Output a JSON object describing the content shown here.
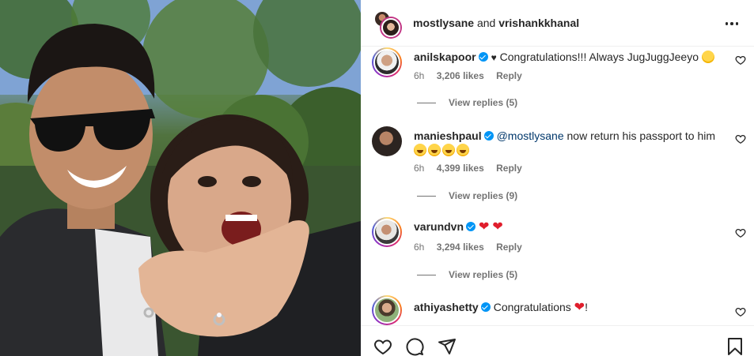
{
  "post": {
    "author": "mostlysane",
    "connector": "and",
    "coauthor": "vrishankkhanal"
  },
  "comments": [
    {
      "user": "anilskapoor",
      "verified": true,
      "prefix": "♥",
      "text": "Congratulations!!! Always JugJuggJeeyo",
      "emoji": "hugging-face",
      "time": "6h",
      "likes": "3,206 likes",
      "reply": "Reply",
      "view_replies": "View replies (5)"
    },
    {
      "user": "manieshpaul",
      "verified": true,
      "mention": "@mostlysane",
      "text": "now return his passport to him",
      "emoji": "rolling-on-floor-laughing x4",
      "time": "6h",
      "likes": "4,399 likes",
      "reply": "Reply",
      "view_replies": "View replies (9)"
    },
    {
      "user": "varundvn",
      "verified": true,
      "text": "",
      "emoji": "red-heart x2",
      "time": "6h",
      "likes": "3,294 likes",
      "reply": "Reply",
      "view_replies": "View replies (5)"
    },
    {
      "user": "athiyashetty",
      "verified": true,
      "text": "Congratulations",
      "suffix": "!",
      "emoji": "red-heart"
    }
  ],
  "actions": {
    "like": "heart-icon",
    "comment": "comment-icon",
    "share": "share-icon",
    "save": "bookmark-icon"
  },
  "colors": {
    "verified": "#0095f6",
    "mention": "#00376b",
    "muted": "#737373",
    "heart": "#e01e2c"
  }
}
